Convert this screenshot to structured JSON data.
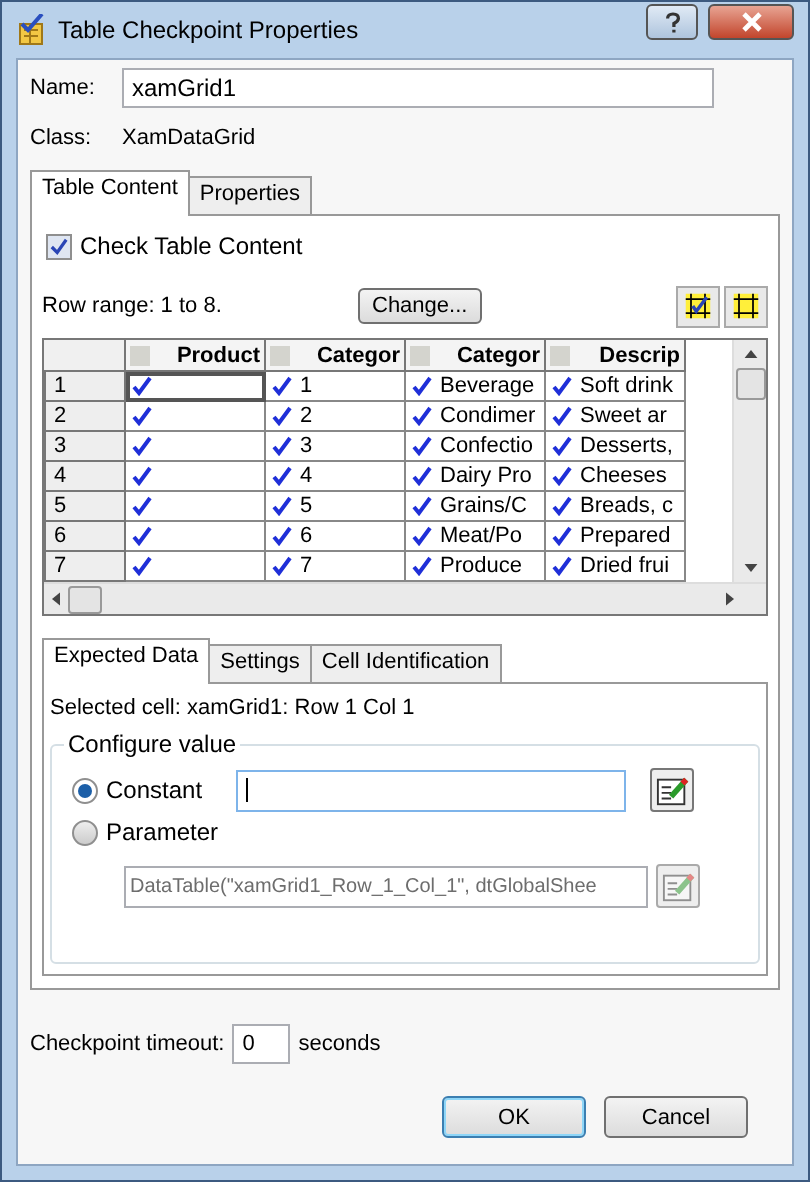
{
  "window": {
    "title": "Table Checkpoint Properties"
  },
  "name": {
    "label": "Name:",
    "value": "xamGrid1"
  },
  "class": {
    "label": "Class:",
    "value": "XamDataGrid"
  },
  "tabs": [
    {
      "label": "Table Content",
      "selected": true
    },
    {
      "label": "Properties",
      "selected": false
    }
  ],
  "check_table_content": {
    "label": "Check Table Content",
    "checked": true
  },
  "row_range": "Row range: 1 to 8.",
  "change_button": "Change...",
  "grid": {
    "columns": [
      "Product",
      "Categor",
      "Categor",
      "Descrip"
    ],
    "rows": [
      {
        "header": "1",
        "cells": [
          {
            "checked": true,
            "selected": true
          },
          {
            "text": "1",
            "checked": true,
            "selected": false
          },
          {
            "text": "Beverage",
            "checked": true,
            "selected": false
          },
          {
            "text": "Soft drink",
            "checked": true,
            "selected": false
          }
        ]
      },
      {
        "header": "2",
        "cells": [
          {
            "checked": true,
            "selected": false
          },
          {
            "text": "2",
            "checked": true,
            "selected": false
          },
          {
            "text": "Condimer",
            "checked": true,
            "selected": false
          },
          {
            "text": "Sweet ar",
            "checked": true,
            "selected": false
          }
        ]
      },
      {
        "header": "3",
        "cells": [
          {
            "checked": true,
            "selected": false
          },
          {
            "text": "3",
            "checked": true,
            "selected": false
          },
          {
            "text": "Confectio",
            "checked": true,
            "selected": false
          },
          {
            "text": "Desserts,",
            "checked": true,
            "selected": false
          }
        ]
      },
      {
        "header": "4",
        "cells": [
          {
            "checked": true,
            "selected": false
          },
          {
            "text": "4",
            "checked": true,
            "selected": false
          },
          {
            "text": "Dairy Pro",
            "checked": true,
            "selected": false
          },
          {
            "text": "Cheeses",
            "checked": true,
            "selected": false
          }
        ]
      },
      {
        "header": "5",
        "cells": [
          {
            "checked": true,
            "selected": false
          },
          {
            "text": "5",
            "checked": true,
            "selected": false
          },
          {
            "text": "Grains/C",
            "checked": true,
            "selected": false
          },
          {
            "text": "Breads, c",
            "checked": true,
            "selected": false
          }
        ]
      },
      {
        "header": "6",
        "cells": [
          {
            "checked": true,
            "selected": false
          },
          {
            "text": "6",
            "checked": true,
            "selected": false
          },
          {
            "text": "Meat/Po",
            "checked": true,
            "selected": false
          },
          {
            "text": "Prepared",
            "checked": true,
            "selected": false
          }
        ]
      },
      {
        "header": "7",
        "cells": [
          {
            "checked": true,
            "selected": false
          },
          {
            "text": "7",
            "checked": true,
            "selected": false
          },
          {
            "text": "Produce",
            "checked": true,
            "selected": false
          },
          {
            "text": "Dried frui",
            "checked": true,
            "selected": false
          }
        ]
      }
    ]
  },
  "sub_tabs": [
    {
      "label": "Expected Data",
      "selected": true
    },
    {
      "label": "Settings",
      "selected": false
    },
    {
      "label": "Cell Identification",
      "selected": false
    }
  ],
  "selected_cell": "Selected cell: xamGrid1: Row 1 Col 1",
  "configure": {
    "title": "Configure value",
    "options": [
      {
        "label": "Constant",
        "selected": true,
        "disabled": false
      },
      {
        "label": "Parameter",
        "selected": false,
        "value": "DataTable(\"xamGrid1_Row_1_Col_1\", dtGlobalShee",
        "disabled": true
      }
    ]
  },
  "timeout": {
    "label": "Checkpoint timeout:",
    "value": "0",
    "unit": "seconds"
  },
  "buttons": [
    {
      "label": "OK",
      "default": true
    },
    {
      "label": "Cancel",
      "default": false
    }
  ]
}
